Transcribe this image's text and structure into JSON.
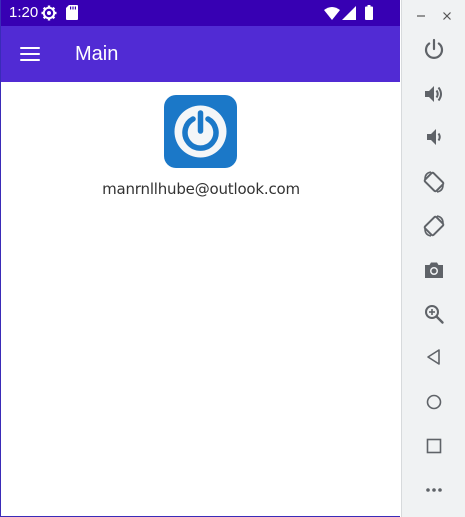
{
  "status_bar": {
    "time": "1:20",
    "color": "#3700b3",
    "icons": [
      "gear-icon",
      "sd-card-icon",
      "wifi-icon",
      "signal-icon",
      "battery-icon"
    ]
  },
  "app_bar": {
    "title": "Main",
    "color": "#512bd4",
    "menu_icon": "hamburger-menu-icon"
  },
  "content": {
    "logo_icon": "power-logo-icon",
    "logo_color": "#1b78c8",
    "email": "manrnllhube@outlook.com"
  },
  "emulator_toolbar": {
    "window_controls": [
      "minimize-icon",
      "close-icon"
    ],
    "buttons": [
      "power-icon",
      "volume-up-icon",
      "volume-down-icon",
      "rotate-left-icon",
      "rotate-right-icon",
      "camera-icon",
      "zoom-icon",
      "back-icon",
      "home-icon",
      "overview-icon",
      "more-icon"
    ]
  }
}
